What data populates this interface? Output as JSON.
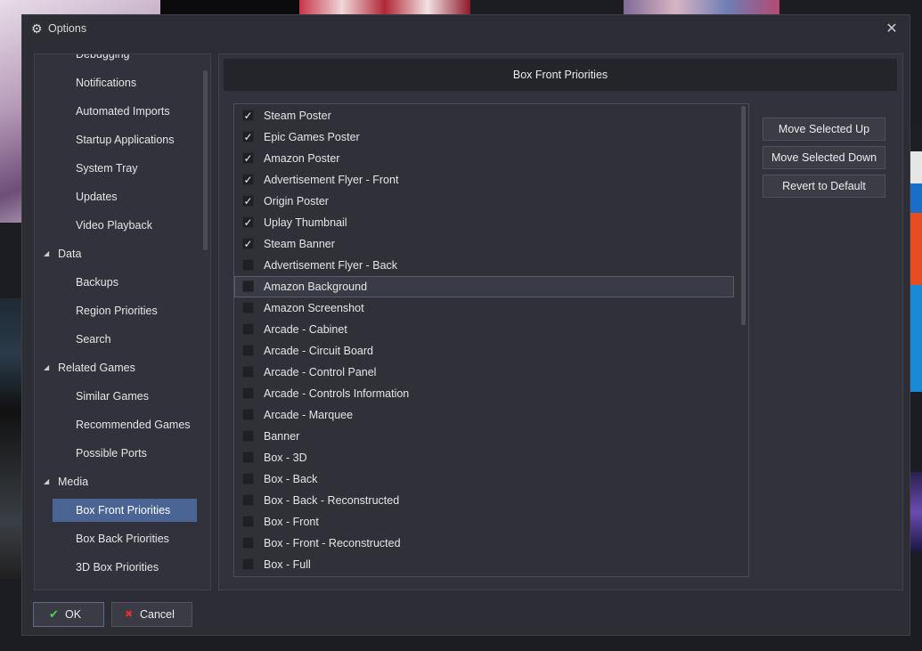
{
  "window": {
    "title": "Options",
    "close_glyph": "✕"
  },
  "sidebar": {
    "items": [
      {
        "label": "Debugging",
        "kind": "child"
      },
      {
        "label": "Notifications",
        "kind": "child"
      },
      {
        "label": "Automated Imports",
        "kind": "child"
      },
      {
        "label": "Startup Applications",
        "kind": "child"
      },
      {
        "label": "System Tray",
        "kind": "child"
      },
      {
        "label": "Updates",
        "kind": "child"
      },
      {
        "label": "Video Playback",
        "kind": "child"
      },
      {
        "label": "Data",
        "kind": "group"
      },
      {
        "label": "Backups",
        "kind": "child"
      },
      {
        "label": "Region Priorities",
        "kind": "child"
      },
      {
        "label": "Search",
        "kind": "child"
      },
      {
        "label": "Related Games",
        "kind": "group"
      },
      {
        "label": "Similar Games",
        "kind": "child"
      },
      {
        "label": "Recommended Games",
        "kind": "child"
      },
      {
        "label": "Possible Ports",
        "kind": "child"
      },
      {
        "label": "Media",
        "kind": "group"
      },
      {
        "label": "Box Front Priorities",
        "kind": "child",
        "selected": true
      },
      {
        "label": "Box Back Priorities",
        "kind": "child"
      },
      {
        "label": "3D Box Priorities",
        "kind": "child"
      }
    ]
  },
  "main": {
    "header": "Box Front Priorities",
    "list": [
      {
        "label": "Steam Poster",
        "checked": true
      },
      {
        "label": "Epic Games Poster",
        "checked": true
      },
      {
        "label": "Amazon Poster",
        "checked": true
      },
      {
        "label": "Advertisement Flyer - Front",
        "checked": true
      },
      {
        "label": "Origin Poster",
        "checked": true
      },
      {
        "label": "Uplay Thumbnail",
        "checked": true
      },
      {
        "label": "Steam Banner",
        "checked": true
      },
      {
        "label": "Advertisement Flyer - Back",
        "checked": false
      },
      {
        "label": "Amazon Background",
        "checked": false,
        "selected": true
      },
      {
        "label": "Amazon Screenshot",
        "checked": false
      },
      {
        "label": "Arcade - Cabinet",
        "checked": false
      },
      {
        "label": "Arcade - Circuit Board",
        "checked": false
      },
      {
        "label": "Arcade - Control Panel",
        "checked": false
      },
      {
        "label": "Arcade - Controls Information",
        "checked": false
      },
      {
        "label": "Arcade - Marquee",
        "checked": false
      },
      {
        "label": "Banner",
        "checked": false
      },
      {
        "label": "Box - 3D",
        "checked": false
      },
      {
        "label": "Box - Back",
        "checked": false
      },
      {
        "label": "Box - Back - Reconstructed",
        "checked": false
      },
      {
        "label": "Box - Front",
        "checked": false
      },
      {
        "label": "Box - Front - Reconstructed",
        "checked": false
      },
      {
        "label": "Box - Full",
        "checked": false
      }
    ],
    "buttons": {
      "move_up": "Move Selected Up",
      "move_down": "Move Selected Down",
      "revert": "Revert to Default"
    }
  },
  "footer": {
    "ok": "OK",
    "cancel": "Cancel"
  },
  "icons": {
    "title": "gear-icon",
    "ok": "checkmark-icon",
    "cancel": "red-x-icon"
  },
  "colors": {
    "selection": "#4a6494",
    "ok_check": "#4cd34a",
    "cancel_x": "#e23030"
  }
}
